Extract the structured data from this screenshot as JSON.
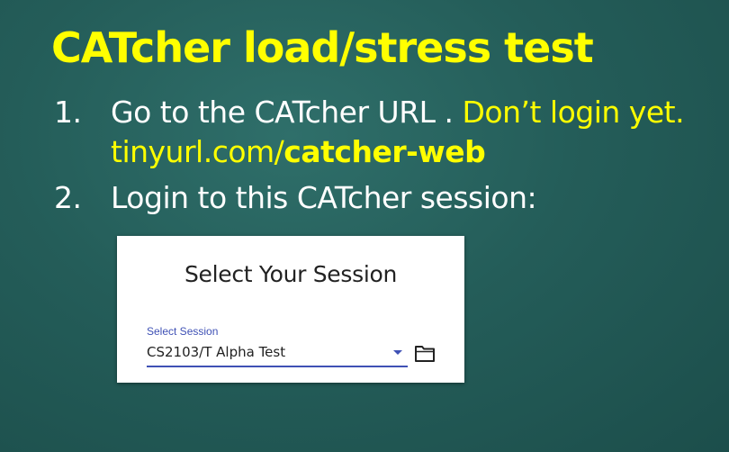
{
  "slide": {
    "title": "CATcher load/stress test",
    "items": [
      {
        "number": "1.",
        "text_white": "Go to the CATcher URL . ",
        "text_yellow": "Don’t login yet.",
        "url_plain": "tinyurl.com/",
        "url_bold": "catcher-web"
      },
      {
        "number": "2.",
        "text": "Login to this CATcher session:"
      }
    ]
  },
  "session_panel": {
    "title": "Select Your Session",
    "field_label": "Select Session",
    "selected_value": "CS2103/T Alpha Test",
    "accent_color": "#3f51b5",
    "dropdown_icon": "arrow-drop-down-icon",
    "folder_icon": "folder-icon"
  },
  "colors": {
    "background": "#245d59",
    "title": "#ffff00",
    "highlight": "#ffff00",
    "text": "#ffffff"
  }
}
